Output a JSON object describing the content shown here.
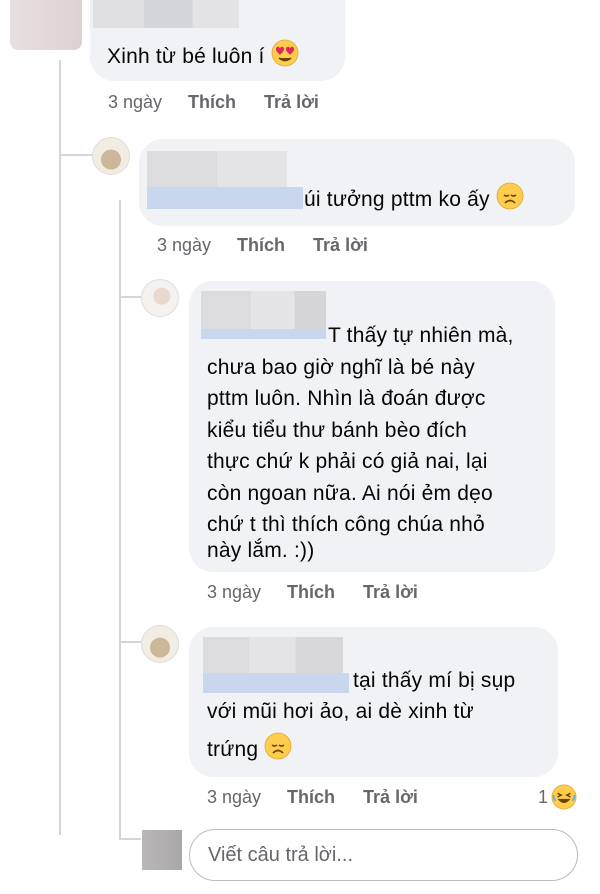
{
  "comments": [
    {
      "text": "Xinh từ bé luôn í",
      "emoji": "heart-eyes-emoji",
      "time": "3 ngày",
      "like_label": "Thích",
      "reply_label": "Trả lời"
    },
    {
      "text": "úi tưởng pttm ko ấy",
      "emoji": "sad-emoji",
      "time": "3 ngày",
      "like_label": "Thích",
      "reply_label": "Trả lời"
    },
    {
      "lines": [
        "T thấy tự nhiên mà,",
        "chưa bao giờ nghĩ là bé này",
        "pttm luôn. Nhìn là đoán được",
        "kiểu tiểu thư bánh bèo đích",
        "thực chứ k phải có giả nai, lại",
        "còn ngoan nữa. Ai nói ẻm dẹo",
        "chứ t thì thích công chúa nhỏ",
        "này lắm. :))"
      ],
      "time": "3 ngày",
      "like_label": "Thích",
      "reply_label": "Trả lời"
    },
    {
      "lines": [
        "tại thấy mí bị sụp",
        "với mũi hơi ảo, ai dè xinh từ",
        "trứng"
      ],
      "emoji": "sad-emoji",
      "time": "3 ngày",
      "like_label": "Thích",
      "reply_label": "Trả lời",
      "reaction_count": "1",
      "reaction_icon": "laughing-emoji"
    }
  ],
  "reply_box": {
    "placeholder": "Viết câu trả lời..."
  },
  "colors": {
    "bubble": "#f0f2f5",
    "meta": "#65676b",
    "emoji": "#ffcc4d"
  }
}
